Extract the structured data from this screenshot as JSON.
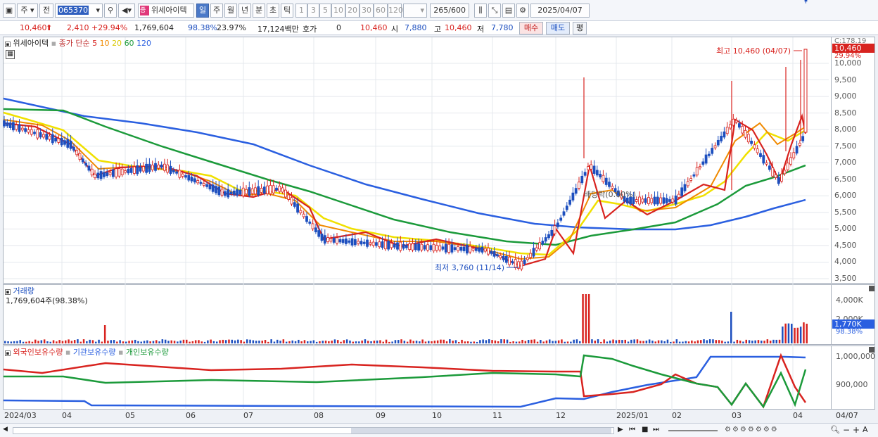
{
  "toolbar": {
    "market": "주",
    "prev": "전",
    "code": "065370",
    "stock_name": "위세아이텍",
    "period_day": "일",
    "period_week": "주",
    "period_month": "월",
    "period_year": "년",
    "period_min": "분",
    "period_sec": "초",
    "period_tick": "틱",
    "intervals": [
      "1",
      "3",
      "5",
      "10",
      "20",
      "30",
      "60",
      "120"
    ],
    "count": "265",
    "count_total": "/600",
    "date": "2025/04/07"
  },
  "quote": {
    "price": "10,460",
    "change": "2,410",
    "change_pct": "+29.94%",
    "volume": "1,769,604",
    "vol_ratio": "98.38%",
    "turnover": "23.97%",
    "amount": "17,124백만",
    "bid_label": "호가",
    "bid_value": "0",
    "ask_price": "10,460",
    "open_label": "시",
    "open": "7,880",
    "high_label": "고",
    "high": "10,460",
    "low_label": "저",
    "low": "7,780",
    "buy_button": "매수",
    "sell_button": "매도",
    "eval_button": "평"
  },
  "price_panel": {
    "name": "위세아이텍",
    "ma_label": "종가 단순",
    "ma_periods": [
      "5",
      "10",
      "20",
      "60",
      "120"
    ],
    "ma_colors": [
      "#d8231f",
      "#f08a00",
      "#f0e000",
      "#1b9a3a",
      "#2a5fe0"
    ],
    "high_annot": "최고 10,460 (04/07)",
    "low_annot": "최저 3,760 (11/14)",
    "rights_annot": "배당락(0.00%)",
    "axis_top": "C:178.19",
    "current_price": "10,460",
    "current_pct": "29.94%",
    "y_ticks": [
      "10,000",
      "9,500",
      "9,000",
      "8,500",
      "8,000",
      "7,500",
      "7,000",
      "6,500",
      "6,000",
      "5,500",
      "5,000",
      "4,500",
      "4,000",
      "3,500"
    ]
  },
  "volume_panel": {
    "title": "거래량",
    "value": "1,769,604주(98.38%)",
    "y_ticks": [
      "4,000K",
      "2,000K"
    ],
    "current": "1,770K",
    "current_pct": "98.38%"
  },
  "holding_panel": {
    "series": [
      "외국인보유수량",
      "기관보유수량",
      "개인보유수량"
    ],
    "colors": [
      "#d8231f",
      "#2a5fe0",
      "#1b9a3a"
    ],
    "y_ticks": [
      "1,000,000",
      "900,000"
    ]
  },
  "x_labels": [
    "2024/03",
    "04",
    "05",
    "06",
    "07",
    "08",
    "09",
    "10",
    "11",
    "12",
    "2025/01",
    "02",
    "03",
    "04"
  ],
  "x_label_last": "04/07"
}
